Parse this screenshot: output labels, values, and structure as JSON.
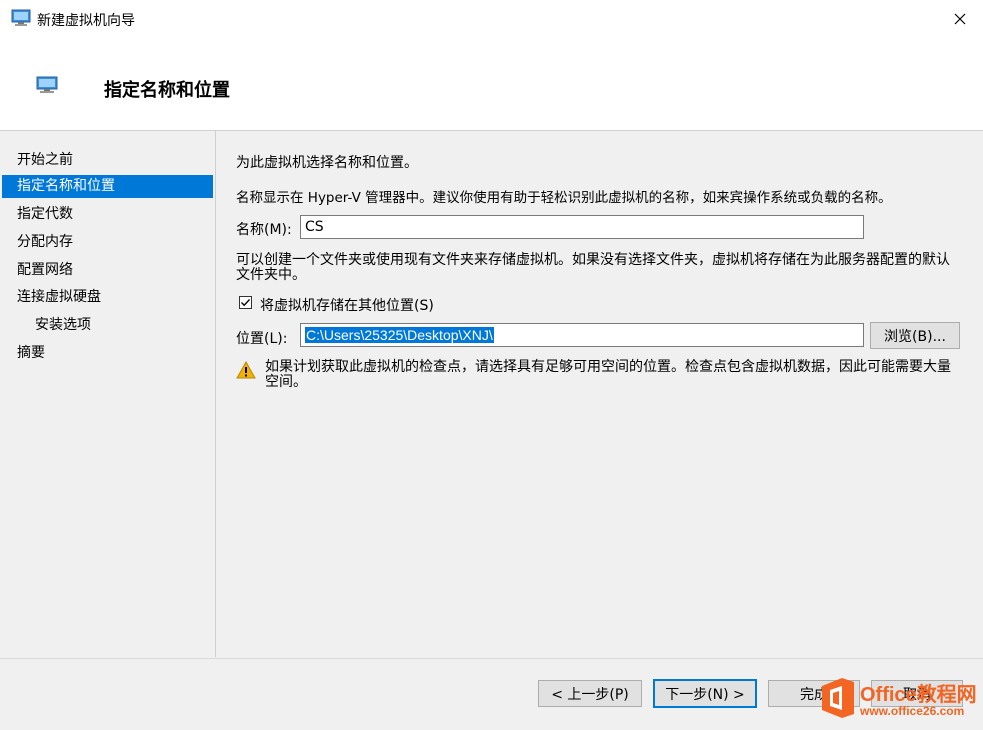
{
  "window": {
    "title": "新建虚拟机向导"
  },
  "header": {
    "title": "指定名称和位置"
  },
  "sidebar": {
    "items": [
      {
        "label": "开始之前"
      },
      {
        "label": "指定名称和位置"
      },
      {
        "label": "指定代数"
      },
      {
        "label": "分配内存"
      },
      {
        "label": "配置网络"
      },
      {
        "label": "连接虚拟硬盘"
      },
      {
        "label": "安装选项"
      },
      {
        "label": "摘要"
      }
    ]
  },
  "content": {
    "intro": "为此虚拟机选择名称和位置。",
    "description": "名称显示在 Hyper-V 管理器中。建议你使用有助于轻松识别此虚拟机的名称，如来宾操作系统或负载的名称。",
    "name_label": "名称(M):",
    "name_value": "CS",
    "folder_info": "可以创建一个文件夹或使用现有文件夹来存储虚拟机。如果没有选择文件夹，虚拟机将存储在为此服务器配置的默认文件夹中。",
    "checkbox_label": "将虚拟机存储在其他位置(S)",
    "location_label": "位置(L):",
    "location_value": "C:\\Users\\25325\\Desktop\\XNJ\\",
    "browse_label": "浏览(B)...",
    "warning": "如果计划获取此虚拟机的检查点，请选择具有足够可用空间的位置。检查点包含虚拟机数据，因此可能需要大量空间。"
  },
  "footer": {
    "prev_label": "< 上一步(P)",
    "next_label": "下一步(N) >",
    "finish_label": "完成",
    "cancel_label": "取消"
  },
  "watermark": {
    "brand": "Office教程网",
    "url": "www.office26.com"
  },
  "colors": {
    "accent": "#0078d7",
    "warning": "#f0b400",
    "watermark": "#f26522"
  }
}
